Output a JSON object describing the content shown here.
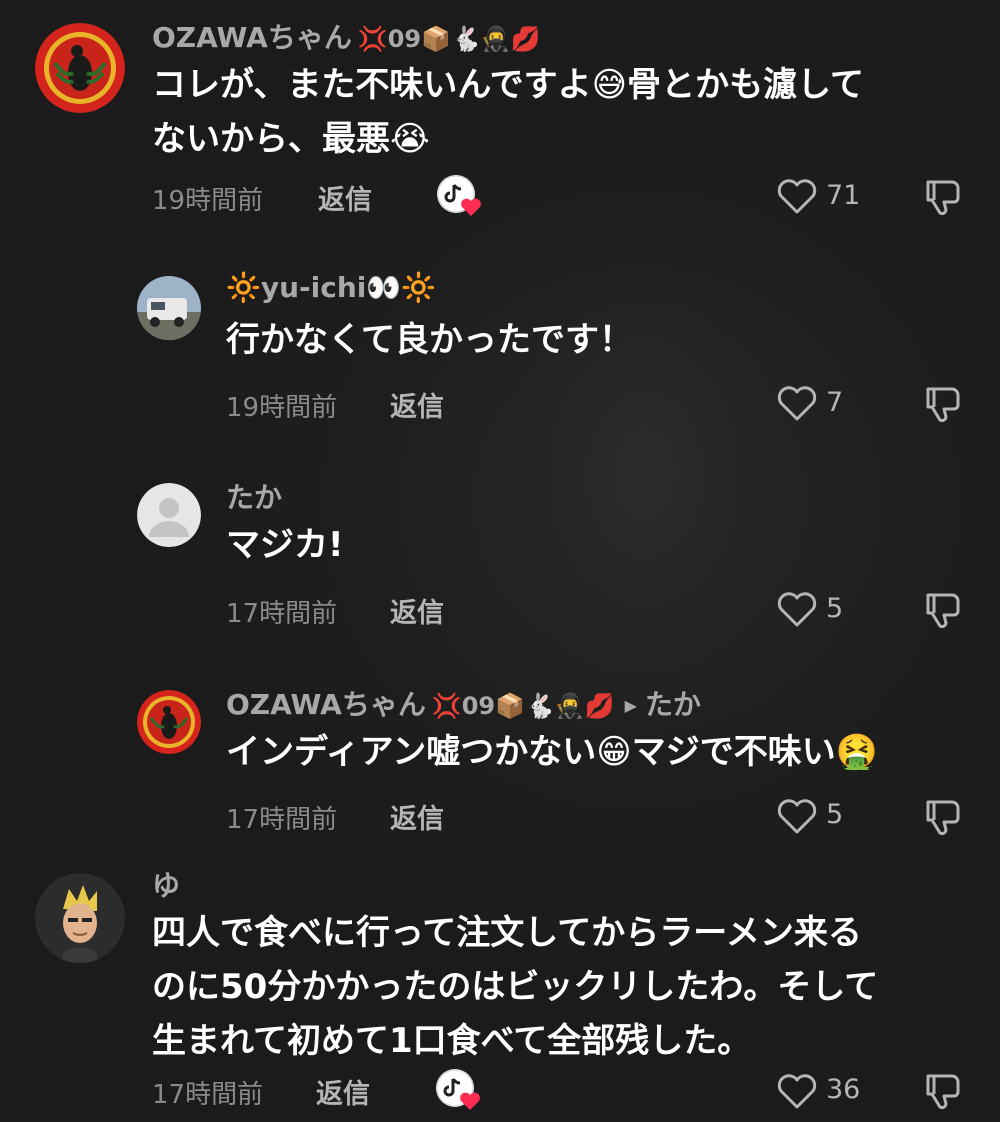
{
  "comments": [
    {
      "username": "OZAWAちゃん",
      "badges": "💢09📦🐇🥷💋",
      "text": "コレが、また不味いんですよ😅骨とかも濾して\nないから、最悪😭",
      "time": "19時間前",
      "reply_label": "返信",
      "likes": "71",
      "creator_liked": true
    },
    {
      "username": "🔆yu-ichi👀🔆",
      "text": "行かなくて良かったです！",
      "time": "19時間前",
      "reply_label": "返信",
      "likes": "7"
    },
    {
      "username": "たか",
      "text": "マジカ!",
      "time": "17時間前",
      "reply_label": "返信",
      "likes": "5"
    },
    {
      "username": "OZAWAちゃん",
      "badges": "💢09📦🐇🥷💋",
      "reply_to": "たか",
      "text": "インディアン嘘つかない😁マジで不味い🤮",
      "time": "17時間前",
      "reply_label": "返信",
      "likes": "5"
    },
    {
      "username": "ゆ",
      "text": "四人で食べに行って注文してからラーメン来る\nのに50分かかったのはビックリしたわ。そして\n生まれて初めて1口食べて全部残した。",
      "time": "17時間前",
      "reply_label": "返信",
      "likes": "36",
      "creator_liked": true
    }
  ],
  "colors": {
    "background": "#1b1b1b",
    "text": "#ffffff",
    "muted": "#8a8a8a",
    "username": "#a8a8a8",
    "heart_accent": "#fe2c55"
  },
  "icons": [
    "heart-outline-icon",
    "thumbs-down-icon",
    "creator-liked-badge-icon",
    "triangle-right-icon"
  ]
}
